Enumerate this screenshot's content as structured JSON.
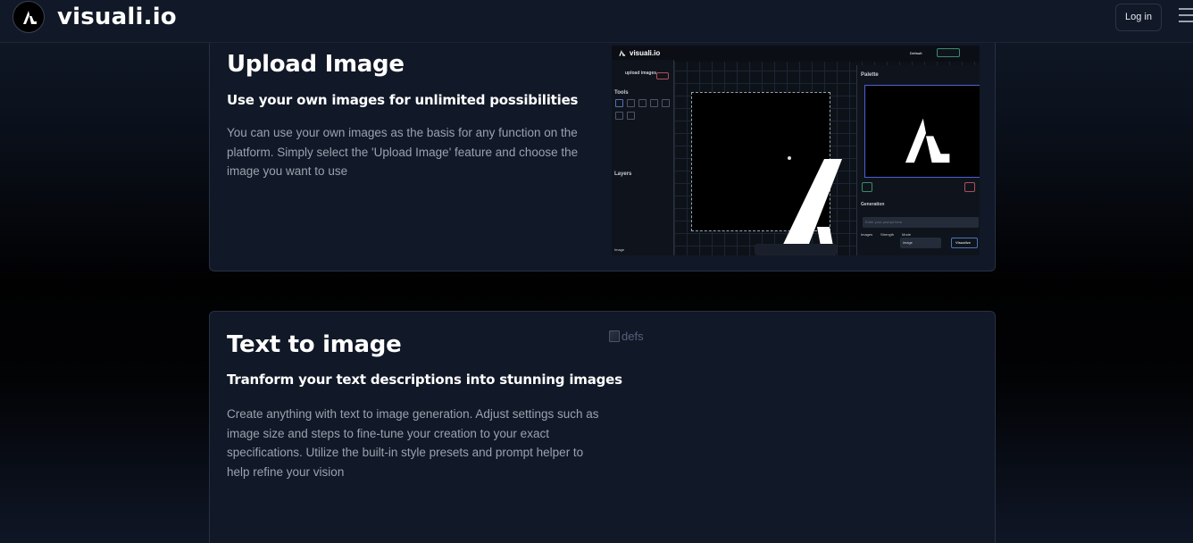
{
  "header": {
    "brand": "visuali.io",
    "login_label": "Log in",
    "icons": {
      "logo": "visuali-logo-icon",
      "menu": "hamburger-menu-icon"
    }
  },
  "features": [
    {
      "title": "Upload Image",
      "subtitle": "Use your own images for unlimited possibilities",
      "description": "You can use your own images as the basis for any function on the platform. Simply select the 'Upload Image' feature and choose the image you want to use",
      "preview": {
        "app_name": "visuali.io",
        "upload_label": "upload images",
        "tools_label": "Tools",
        "layers_label": "Layers",
        "palette_label": "Palette",
        "generation_label": "Generation",
        "prompt_placeholder": "Enter your prompt here",
        "images_label": "Images",
        "strength_label": "Strength",
        "mode_label": "Mode",
        "mode_value": "image",
        "visualize_label": "Visualize",
        "default_label": "Default",
        "image_label": "Image"
      }
    },
    {
      "title": "Text to image",
      "subtitle": "Tranform your text descriptions into stunning images",
      "description": "Create anything with text to image generation. Adjust settings such as image size and steps to fine-tune your creation to your exact specifications. Utilize the built-in style presets and prompt helper to help refine your vision",
      "image_alt": "defs"
    }
  ],
  "colors": {
    "card_bg": "#111827",
    "card_border": "#283042",
    "text_muted": "#9aa2ae",
    "accent": "#4d5fd8"
  }
}
